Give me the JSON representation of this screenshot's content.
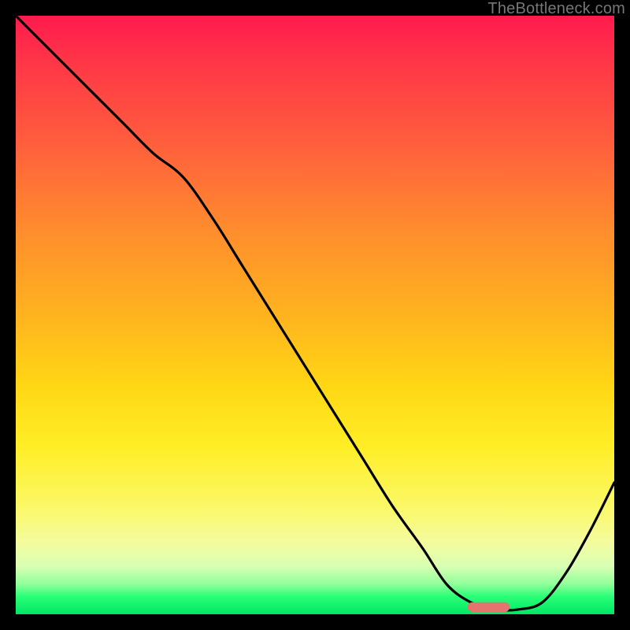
{
  "watermark": "TheBottleneck.com",
  "colors": {
    "gradient_top": "#ff1a4d",
    "gradient_mid": "#ffd714",
    "gradient_bottom": "#00e765",
    "curve": "#000000",
    "marker": "#e5736e",
    "frame": "#000000"
  },
  "chart_data": {
    "type": "line",
    "title": "",
    "xlabel": "",
    "ylabel": "",
    "xlim": [
      0,
      100
    ],
    "ylim": [
      0,
      100
    ],
    "legend": false,
    "grid": false,
    "series": [
      {
        "name": "bottleneck-curve",
        "x": [
          0,
          6,
          12,
          18,
          23,
          28,
          33,
          38,
          43,
          48,
          53,
          58,
          63,
          68,
          72,
          76,
          80,
          84,
          88,
          92,
          96,
          100
        ],
        "y": [
          100,
          94,
          88,
          82,
          77,
          73,
          66,
          58,
          50,
          42,
          34,
          26,
          18,
          11,
          5,
          2,
          0.8,
          0.8,
          2,
          7,
          14,
          22
        ]
      }
    ],
    "annotations": [
      {
        "name": "optimal-marker",
        "shape": "rounded-bar",
        "x": 79,
        "y": 1.2,
        "width_pct": 7,
        "height_pct": 1.6
      }
    ]
  }
}
